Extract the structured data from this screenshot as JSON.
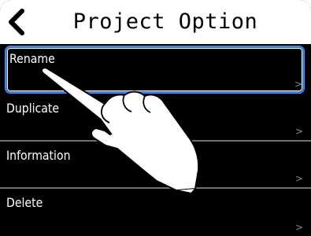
{
  "header": {
    "title": "Project Option",
    "back_icon": "chevron-left-icon"
  },
  "menu": {
    "items": [
      {
        "label": "Rename",
        "chevron": ">"
      },
      {
        "label": "Duplicate",
        "chevron": ">"
      },
      {
        "label": "Information",
        "chevron": ">"
      },
      {
        "label": "Delete",
        "chevron": ">"
      }
    ],
    "selected_index": 0
  },
  "overlay": {
    "type": "pointing-hand"
  },
  "colors": {
    "background": "#000000",
    "header": "#ffffff",
    "selection": "#3a7bd5"
  }
}
